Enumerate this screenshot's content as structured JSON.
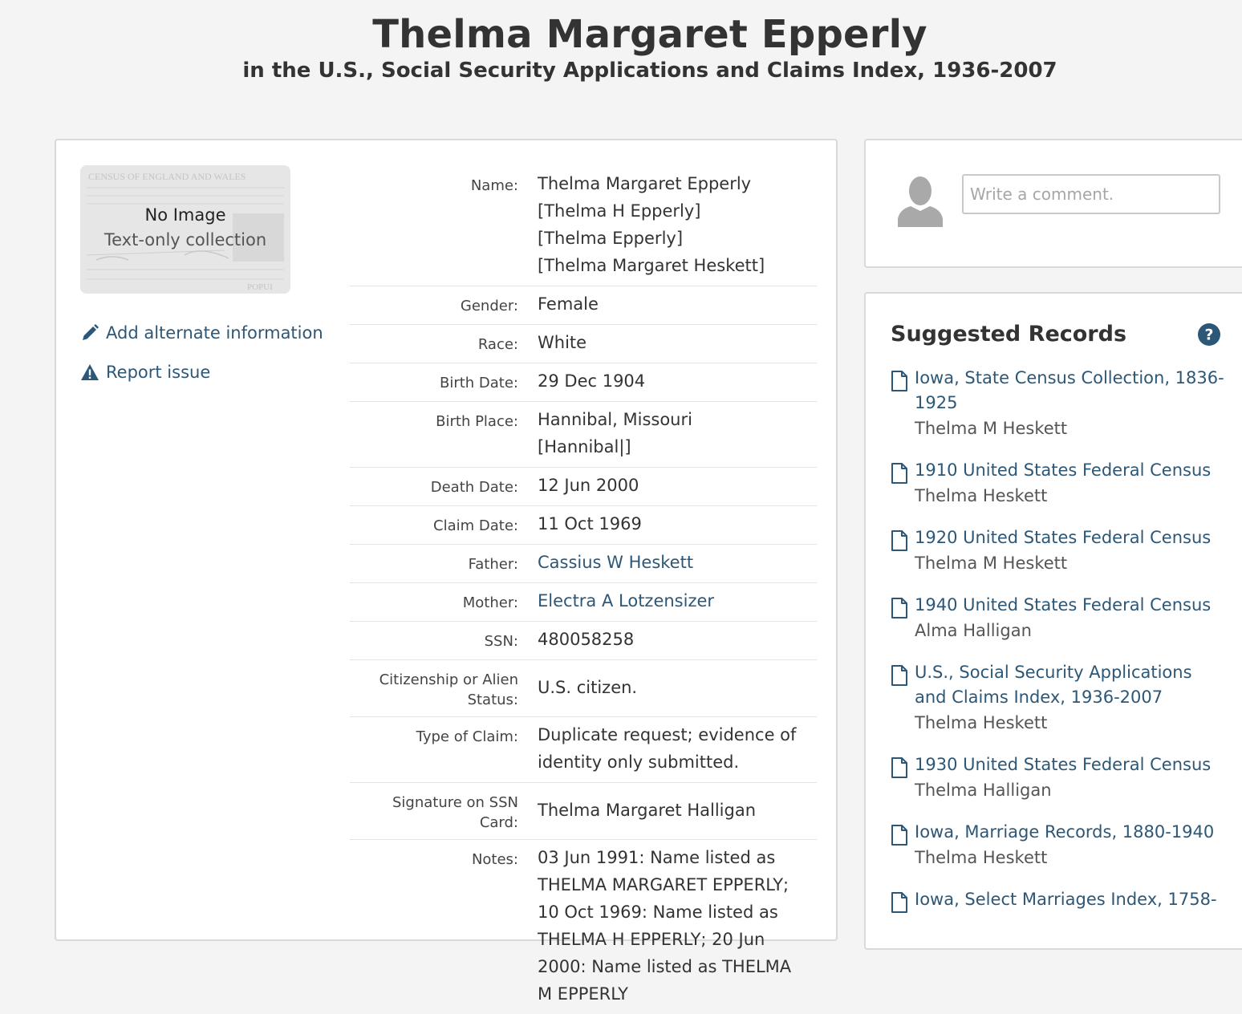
{
  "header": {
    "title": "Thelma Margaret Epperly",
    "subtitle": "in the U.S., Social Security Applications and Claims Index, 1936-2007"
  },
  "thumbnail": {
    "line1": "No Image",
    "line2": "Text-only collection"
  },
  "actions": {
    "add_alternate": "Add alternate information",
    "report_issue": "Report issue"
  },
  "fields": {
    "name": {
      "label": "Name:",
      "values": [
        "Thelma Margaret Epperly",
        "[Thelma H Epperly]",
        "[Thelma Epperly]",
        "[Thelma Margaret Heskett]"
      ]
    },
    "gender": {
      "label": "Gender:",
      "value": "Female"
    },
    "race": {
      "label": "Race:",
      "value": "White"
    },
    "birth_date": {
      "label": "Birth Date:",
      "value": "29 Dec 1904"
    },
    "birth_place": {
      "label": "Birth Place:",
      "values": [
        "Hannibal, Missouri",
        "[Hannibal|]"
      ]
    },
    "death_date": {
      "label": "Death Date:",
      "value": "12 Jun 2000"
    },
    "claim_date": {
      "label": "Claim Date:",
      "value": "11 Oct 1969"
    },
    "father": {
      "label": "Father:",
      "value": "Cassius W Heskett"
    },
    "mother": {
      "label": "Mother:",
      "value": "Electra A Lotzensizer"
    },
    "ssn": {
      "label": "SSN:",
      "value": "480058258"
    },
    "citizenship": {
      "label_line1": "Citizenship or Alien",
      "label_line2": "Status:",
      "value": "U.S. citizen."
    },
    "claim_type": {
      "label": "Type of Claim:",
      "value": "Duplicate request; evidence of identity only submitted."
    },
    "signature": {
      "label_line1": "Signature on SSN",
      "label_line2": "Card:",
      "value": "Thelma Margaret Halligan"
    },
    "notes": {
      "label": "Notes:",
      "value": "03 Jun 1991: Name listed as THELMA MARGARET EPPERLY; 10 Oct 1969: Name listed as THELMA H EPPERLY; 20 Jun 2000: Name listed as THELMA M EPPERLY"
    }
  },
  "comment": {
    "placeholder": "Write a comment."
  },
  "suggested": {
    "title": "Suggested Records",
    "items": [
      {
        "title": "Iowa, State Census Collection, 1836-1925",
        "name": "Thelma M Heskett"
      },
      {
        "title": "1910 United States Federal Census",
        "name": "Thelma Heskett"
      },
      {
        "title": "1920 United States Federal Census",
        "name": "Thelma M Heskett"
      },
      {
        "title": "1940 United States Federal Census",
        "name": "Alma Halligan"
      },
      {
        "title": "U.S., Social Security Applications and Claims Index, 1936-2007",
        "name": "Thelma Heskett"
      },
      {
        "title": "1930 United States Federal Census",
        "name": "Thelma Halligan"
      },
      {
        "title": "Iowa, Marriage Records, 1880-1940",
        "name": "Thelma Heskett"
      },
      {
        "title": "Iowa, Select Marriages Index, 1758-",
        "name": ""
      }
    ]
  },
  "colors": {
    "link": "#2c5777",
    "page_bg": "#f4f4f4",
    "card_border": "#d9d9d9",
    "heading": "#333333"
  },
  "icons": [
    "pencil-icon",
    "warning-icon",
    "avatar-icon",
    "help-icon",
    "document-icon"
  ]
}
